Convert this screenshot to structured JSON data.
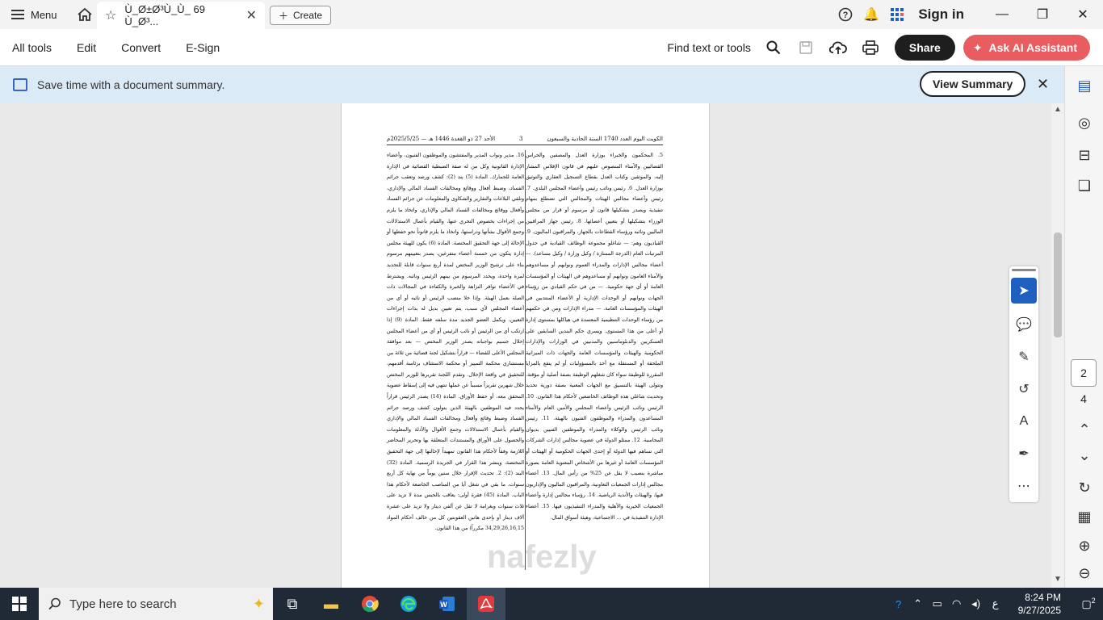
{
  "titlebar": {
    "menu_label": "Menu",
    "tab_title": "Ù_Ø±Ø³Ù_Ù_ 69 Ù_Ø³...",
    "create_label": "Create",
    "sign_in": "Sign in"
  },
  "toolbar": {
    "menus": [
      "All tools",
      "Edit",
      "Convert",
      "E-Sign"
    ],
    "find_label": "Find text or tools",
    "share_label": "Share",
    "ai_label": "Ask AI Assistant"
  },
  "banner": {
    "text": "Save time with a document summary.",
    "button": "View Summary"
  },
  "document": {
    "header_right": "الكويت اليوم العدد 1740 السنة الحادية والسبعون",
    "header_page": "3",
    "header_left": "الأحد 27 ذو القعدة 1446 هـ — 2025/5/25م",
    "col_right": "5. المحكمون والخبراء بوزارة العدل والمصفين والحراس القضائيين والأمناء المنصوص عليهم في قانون الإفلاس المشار إليه، والموثقين وكتاب العدل بقطاع التسجيل العقاري والتوثيق بوزارة العدل. 6. رئيس ونائب رئيس وأعضاء المجلس البلدي. 7. رئيس وأعضاء مجالس الهيئات والمجالس التي تضطلع بمهام تنفيذية ويصدر بتشكيلها قانون أو مرسوم أو قرار من مجلس الوزراء بتشكيلها أو بتعيين أعضائها. 8. رئيس جهاز المراقبين الماليين ونائبه ورؤساء القطاعات بالجهاز، والمراقبون الماليون. 9. القياديون وهم: — شاغلو مجموعة الوظائف القيادية في جدول المرتبات العام (الدرجة الممتازة / وكيل وزارة / وكيل مساعد). — أعضاء مجالس الإدارات والمدراء العموم ونوابهم أو مساعدوهم والأمناء العامون ونوابهم أو مساعدوهم في الهيئات أو المؤسسات العامة أو أي جهة حكومية. — من في حكم القيادي من رؤساء الجهات ونوابهم أو الوحدات الإدارية أو الأعضاء المنتدبين في الهيئات والمؤسسات العامة. — مدراء الإدارات ومن في حكمهم من رؤساء الوحدات التنظيمية المعتمدة في هياكلها بمستوى إدارة أو أعلى من هذا المستوى. ويسري حكم البندين السابقين على العسكريين والدبلوماسيين والمدنيين في الوزارات والإدارات الحكومية والهيئات والمؤسسات العامة والجهات ذات الميزانية الملحقة أو المستقلة مع أخذ بالمسؤوليات أو لم ينقع بالمزايا المقررة للوظيفة سواء كان شغلهم الوظيفة بصفة أصلية أو مؤقتة. وتتولى الهيئة بالتنسيق مع الجهات المعنية بصفة دورية تحديد وتحديث شاغلي هذه الوظائف الخاضعين لأحكام هذا القانون. 10. الرئيس ونائب الرئيس وأعضاء المجلس والأمين العام والأمناء المساعدون والمدراء والموظفون الفنيون بالهيئة. 11. رئيس ونائب الرئيس والوكلاء والمدراء والموظفين الفنيين بديوان المحاسبة. 12. ممثلو الدولة في عضوية مجالس إدارات الشركات التي تساهم فيها الدولة أو إحدى الجهات الحكومية أو الهيئات أو المؤسسات العامة أو غيرها من الأشخاص المعنوية العامة بصورة مباشرة بنصيب لا يقل عن 25% من رأس المال. 13. أعضاء مجالس إدارات الجمعيات التعاونية، والمراقبون الماليون والإداريون فيها، والهيئات والأندية الرياضية. 14. رؤساء مجالس إدارة وأعضاء الجمعيات الخيرية والأهلية والمدراء التنفيذيون فيها. 15. أعضاء الإدارة التنفيذية في ... الاجتماعية، وهيئة أسواق المال.",
    "col_left": "16. مدير ونواب المدير والمفتشون والموظفون الفنيون، وأعضاء الإدارة القانونية وكل من له صفة الضبطية القضائية في الإدارة العامة للجمارك. المادة (5) بند (2): كشف ورصد وتعقب جرائم الفساد، وضبط أفعال ووقائع ومخالفات الفساد المالي والإداري، وتلقي البلاغات والتقارير والشكاوى والمعلومات عن جرائم الفساد وأفعال ووقائع ومخالفات الفساد المالي والإداري، واتخاذ ما يلزم من إجراءات بخصوص التحري عنها، والقيام بأعمال الاستدلالات وجمع الأقوال بشأنها ودراستها، واتخاذ ما يلزم قانوناً نحو حفظها أو الإحالة إلى جهة التحقيق المختصة. المادة (6) يكون للهيئة مجلس إدارة يتكون من خمسة أعضاء متفرغين، يصدر بتعيينهم مرسوم بناء على ترشيح الوزير المختص لمدة أربع سنوات قابلة للتجديد لمرة واحدة، ويحدد المرسوم من بينهم الرئيس ونائبه. ويشترط في الأعضاء توافر النزاهة والخبرة والكفاءة في المجالات ذات الصلة بعمل الهيئة. وإذا خلا منصب الرئيس أو نائبه أو أي من أعضاء المجلس لأي سبب، يتم تعيين بديل له بذات إجراءات التعيين، ويكمل العضو الجديد مدة سلفه فقط. المادة (9) إذا ارتكب أي من الرئيس أو نائب الرئيس أو أي من أعضاء المجلس إخلال جسيم بواجباته يصدر الوزير المختص — بعد موافقة المجلس الأعلى للقضاء — قراراً بتشكيل لجنة قضائية من ثلاثة من مستشاري محكمة التمييز أو محكمة الاستئناف برئاسة أقدمهم، للتحقيق في واقعة الإخلال. وتقدم اللجنة تقريرها للوزير المختص خلال شهرين تقريراً مسبباً عن عملها تنتهي فيه إلى إسقاط عضوية المحقق معه، أو حفظ الأوراق. المادة (14) يصدر الرئيس قراراً يحدد فيه الموظفين بالهيئة الذين يتولون كشف ورصد جرائم الفساد وضبط وقائع وأفعال ومخالفات الفساد المالي والإداري والقيام بأعمال الاستدلالات وجمع الأقوال والأدلة والمعلومات والحصول على الأوراق والمستندات المتعلقة بها وتحرير المحاضر اللازمة وفقاً لأحكام هذا القانون تمهيداً لإحالتها إلى جهة التحقيق المختصة، وينشر هذا القرار في الجريدة الرسمية. المادة (32) البند (2): 2. تحديث الإقرار خلال ستين يوماً من نهاية كل أربع سنوات، ما بقي في شغل أيا من المناصب الخاضعة لأحكام هذا الباب. المادة (45) فقرة أولى: يعاقب بالحبس مدة لا تزيد على ثلاث سنوات وبغرامة لا تقل عن ألفي دينار ولا تزيد على عشرة آلاف دينار أو بإحدى هاتين العقوبتين كل من خالف أحكام المواد 34,29,26,16,15 مكرراً) من هذا القانون."
  },
  "watermark": "nafezly",
  "page_nav": {
    "current": "2",
    "total": "4"
  },
  "taskbar": {
    "search_placeholder": "Type here to search",
    "time": "8:24 PM",
    "date": "9/27/2025",
    "lang": "ع",
    "notif_count": "2"
  }
}
